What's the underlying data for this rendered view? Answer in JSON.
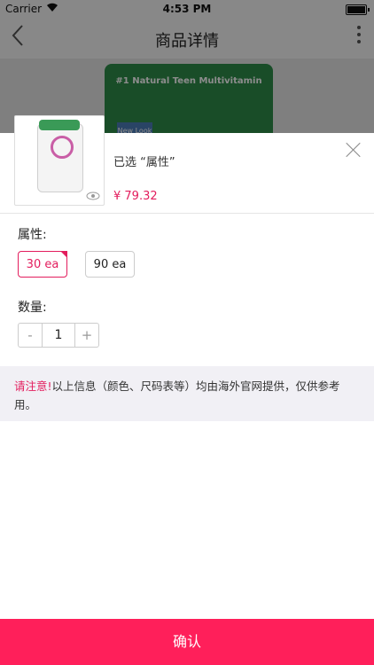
{
  "status_bar": {
    "carrier": "Carrier",
    "time": "4:53 PM"
  },
  "nav": {
    "title": "商品详情",
    "back_icon": "chevron-left-icon",
    "more_icon": "more-vertical-icon"
  },
  "background_product": {
    "bottle_label": "#1 Natural Teen Multivitamin",
    "tag": "New Look"
  },
  "sheet": {
    "selected_label": "已选 “属性”",
    "price": "¥ 79.32",
    "close_icon": "close-icon",
    "thumbnail_icon": "eye-icon",
    "attribute": {
      "label": "属性:",
      "options": [
        {
          "label": "30 ea",
          "selected": true
        },
        {
          "label": "90 ea",
          "selected": false
        }
      ]
    },
    "quantity": {
      "label": "数量:",
      "value": "1",
      "minus": "-",
      "plus": "+"
    },
    "notice": {
      "warning": "请注意!",
      "text": "以上信息（颜色、尺码表等）均由海外官网提供，仅供参考用。"
    },
    "confirm_label": "确认"
  },
  "colors": {
    "accent": "#e31d5d",
    "confirm_bg": "#ff1f5a",
    "notice_bg": "#f1f0f5"
  }
}
